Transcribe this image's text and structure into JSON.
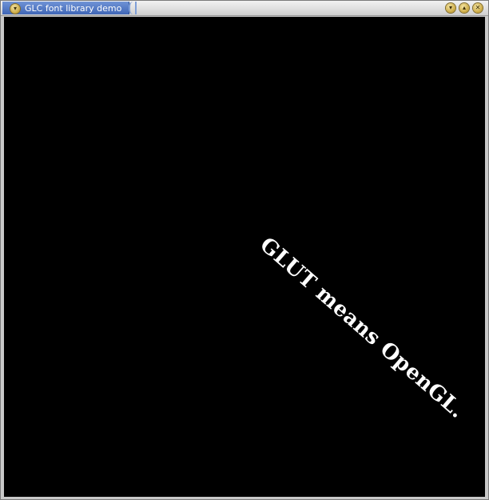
{
  "window": {
    "title": "GLC font library demo",
    "menu_icon": "chevron-down-icon",
    "controls": {
      "minimize_icon": "minimize-icon",
      "maximize_icon": "maximize-icon",
      "close_icon": "close-icon"
    }
  },
  "canvas": {
    "background": "#000000",
    "rendered_text": "GLUT means OpenGL.",
    "text_color": "#ffffff"
  }
}
